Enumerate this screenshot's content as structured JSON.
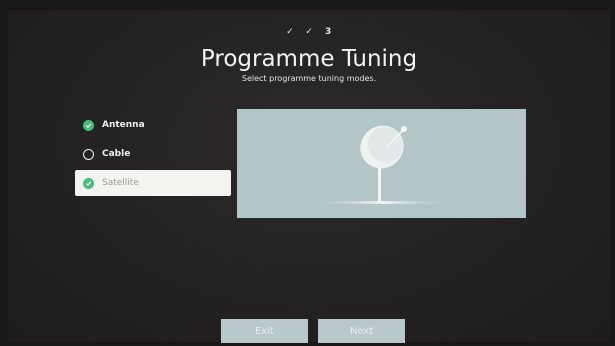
{
  "steps": {
    "step1": "✓",
    "step2": "✓",
    "step3": "3"
  },
  "title": "Programme Tuning",
  "subtitle": "Select programme tuning modes.",
  "options": [
    {
      "label": "Antenna",
      "state": "checked"
    },
    {
      "label": "Cable",
      "state": "unchecked"
    },
    {
      "label": "Satellite",
      "state": "checked-selected"
    }
  ],
  "illustration": {
    "icon": "satellite-dish-icon"
  },
  "buttons": {
    "exit": "Exit",
    "next": "Next"
  },
  "colors": {
    "check": "#41c07a",
    "panel": "#b4c5c7",
    "selected_bg": "#f3f3ef"
  }
}
